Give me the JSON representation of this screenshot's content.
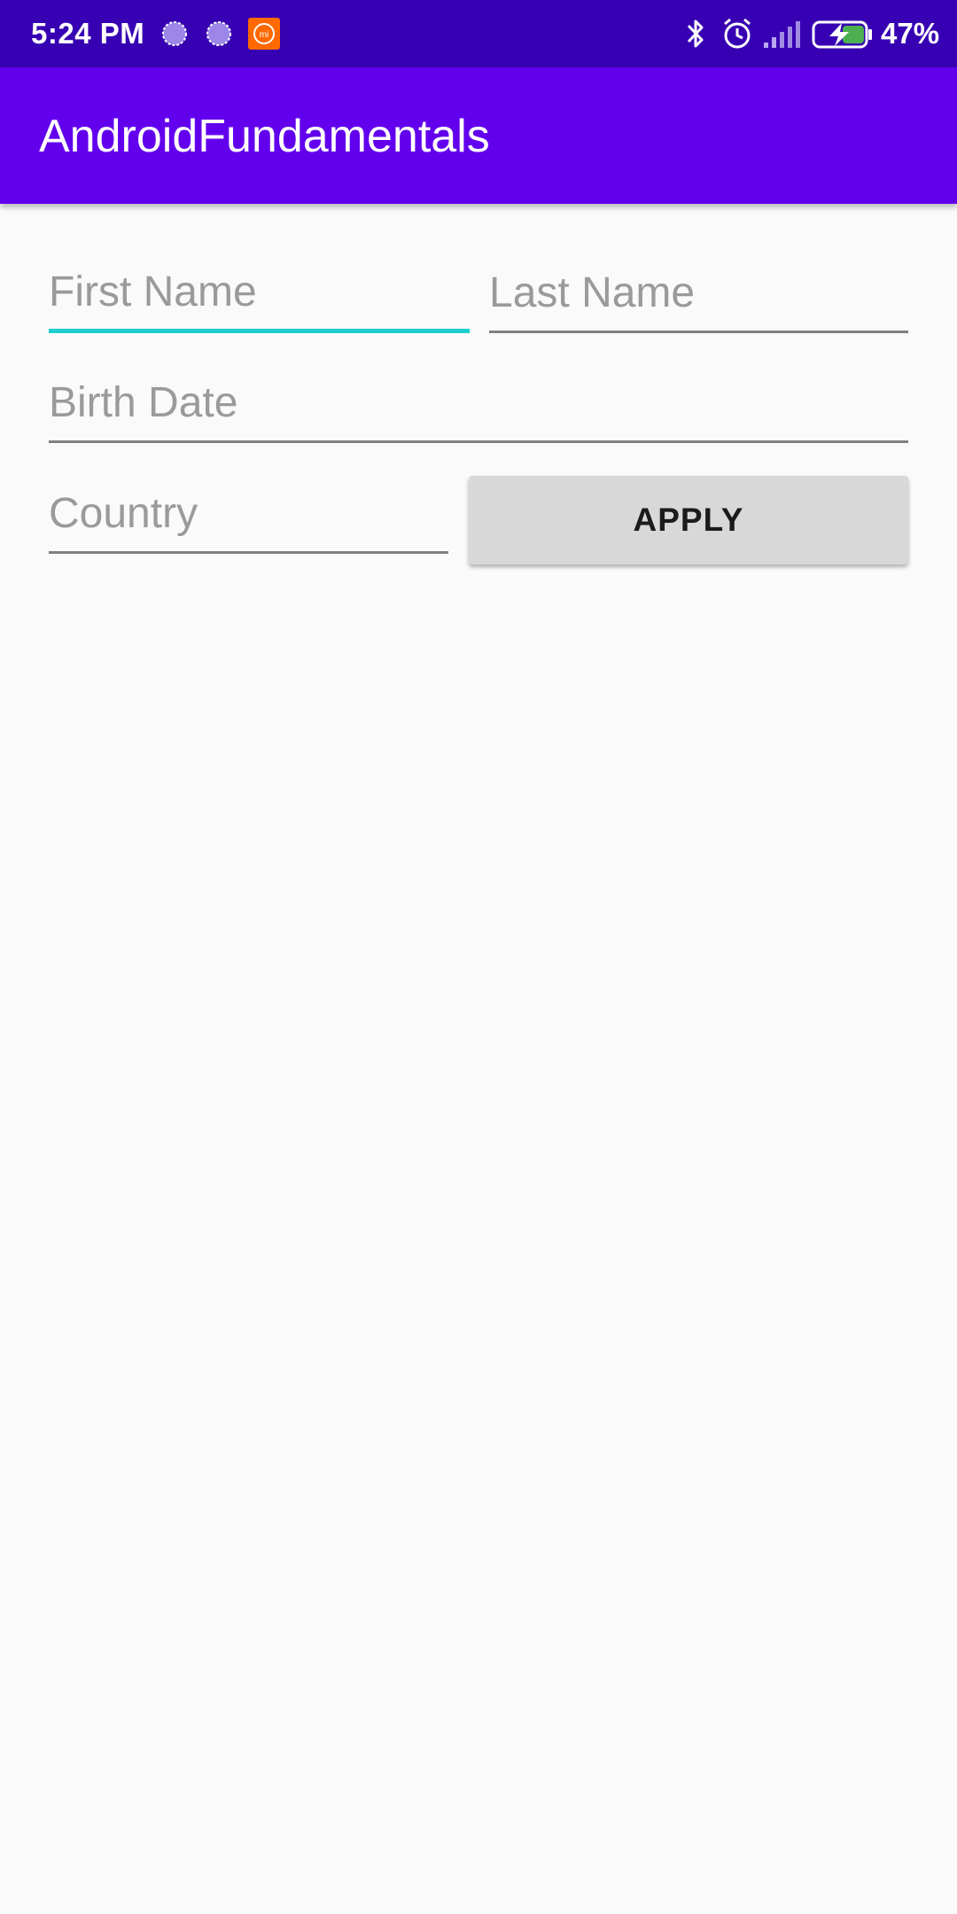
{
  "status_bar": {
    "time": "5:24 PM",
    "battery_percent": "47%",
    "battery_level": 0.47,
    "notification_icons": [
      "purple-circle-icon",
      "purple-circle-icon",
      "mi-icon"
    ],
    "system_icons": [
      "bluetooth-icon",
      "alarm-icon",
      "signal-icon",
      "battery-charging-icon"
    ],
    "background": "#3700b3"
  },
  "app_bar": {
    "title": "AndroidFundamentals",
    "background": "#6200ee"
  },
  "form": {
    "first_name": {
      "placeholder": "First Name",
      "value": ""
    },
    "last_name": {
      "placeholder": "Last Name",
      "value": ""
    },
    "birth_date": {
      "placeholder": "Birth Date",
      "value": ""
    },
    "country": {
      "placeholder": "Country",
      "value": ""
    },
    "apply_label": "APPLY",
    "focus_color": "#1fcfcf"
  }
}
